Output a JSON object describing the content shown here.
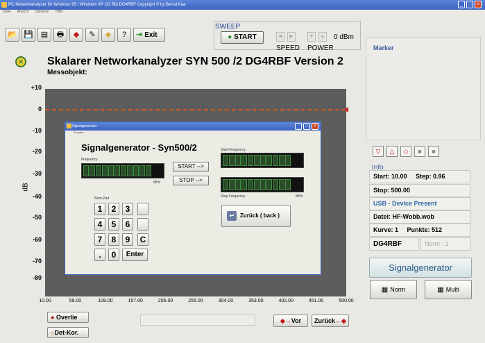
{
  "window": {
    "title": "PC-Networkanalyzer für Windows 95 / Windows XP   (32 Bit)        DG4RBF          Copyright © by Bernd Kaa",
    "menu": [
      "Datei",
      "Ansicht",
      "Optionen",
      "Hilfe"
    ]
  },
  "toolbar": {
    "exit_label": "Exit"
  },
  "sweep": {
    "label": "SWEEP",
    "start_label": "START",
    "speed_label": "SPEED",
    "power_label": "POWER",
    "power_value": "0 dBm"
  },
  "header": {
    "title": "Skalarer Networkanalyzer  SYN 500 /2   DG4RBF   Version 2",
    "messobjekt": "Messobjekt:"
  },
  "plot": {
    "y_unit": "dB",
    "y_ticks": [
      "+10",
      "0",
      "-10",
      "-20",
      "-30",
      "-40",
      "-50",
      "-60",
      "-70",
      "-80"
    ],
    "x_ticks": [
      "10.00",
      "59.00",
      "108.00",
      "157.00",
      "206.00",
      "255.00",
      "304.00",
      "353.00",
      "402.00",
      "451.00",
      "500.00"
    ]
  },
  "chart_data": {
    "type": "line",
    "xlabel": "",
    "ylabel": "dB",
    "xlim": [
      10,
      500
    ],
    "ylim": [
      -80,
      10
    ],
    "series": [
      {
        "values": [
          0,
          0
        ],
        "x": [
          10,
          500
        ]
      }
    ],
    "grid": false
  },
  "bottom": {
    "overlie_label": "Overlie",
    "detkor_label": "Det-Kor.",
    "vor_label": "Vor",
    "zurueck_label": "Zurück"
  },
  "right": {
    "marker_label": "Marker",
    "info_label": "Info",
    "start": "Start: 10.00",
    "step": "Step: 0.96",
    "stop": "Stop: 500.00",
    "usb": "USB - Device Present",
    "datei": "Datei:  HF-Wobb.wob",
    "kurve": "Kurve: 1",
    "punkte": "Punkte: 512",
    "callsign": "DG4RBF",
    "norm_value": "Norm : 1",
    "signalgen_label": "Signalgenerator",
    "norm_label": "Norm",
    "multi_label": "Multi"
  },
  "dialog": {
    "title": "Signalgenerator",
    "menu": "Eingabe",
    "heading": "Signalgenerator - Syn500/2",
    "frequency_label": "Frequency",
    "mhz_label": "MHz",
    "start_btn": "START -->",
    "stop_btn": "STOP -->",
    "start_freq_label": "Start-Frequency",
    "stop_freq_label": "Stop-Frequency",
    "numpad_label": "Num-Pad",
    "keys": [
      "1",
      "2",
      "3",
      "4",
      "5",
      "6",
      "7",
      "8",
      "9",
      "C",
      ".",
      "0",
      "Enter"
    ],
    "back_label": "Zurück ( back )"
  }
}
